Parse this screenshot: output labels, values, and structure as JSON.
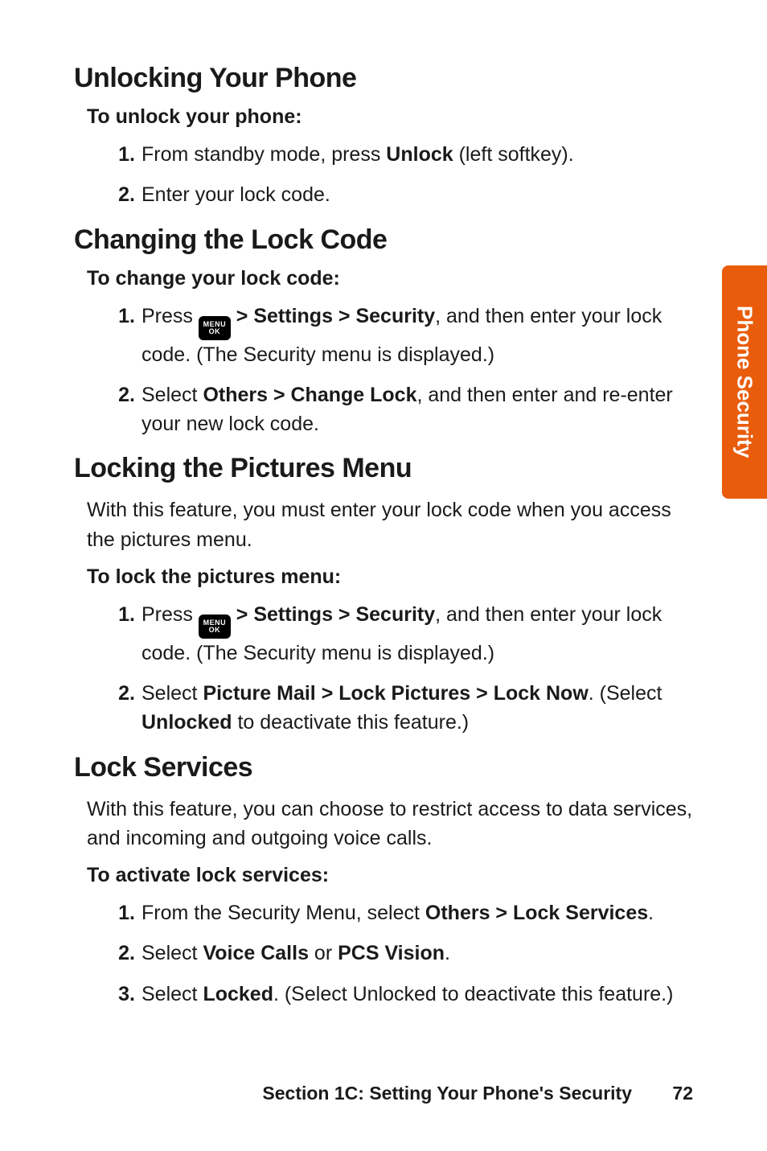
{
  "tab": {
    "label": "Phone Security"
  },
  "s1": {
    "heading": "Unlocking Your Phone",
    "lead": "To unlock your phone:",
    "step1_num": "1.",
    "step1_a": "From standby mode, press ",
    "step1_b": "Unlock",
    "step1_c": " (left softkey).",
    "step2_num": "2.",
    "step2": "Enter your lock code."
  },
  "s2": {
    "heading": "Changing the Lock Code",
    "lead": "To change your lock code:",
    "step1_num": "1.",
    "step1_a": "Press ",
    "step1_b": " > Settings > Security",
    "step1_c": ", and then enter your lock code. (The Security menu is displayed.)",
    "step2_num": "2.",
    "step2_a": "Select ",
    "step2_b": "Others > Change Lock",
    "step2_c": ", and then enter and re-enter your new lock code."
  },
  "s3": {
    "heading": "Locking the Pictures Menu",
    "intro": "With this feature, you must enter your lock code when you access the pictures menu.",
    "lead": "To lock the pictures menu:",
    "step1_num": "1.",
    "step1_a": "Press ",
    "step1_b": " > Settings > Security",
    "step1_c": ", and then enter your lock code. (The Security menu is displayed.)",
    "step2_num": "2.",
    "step2_a": "Select ",
    "step2_b": "Picture Mail > Lock Pictures > Lock Now",
    "step2_c": ". (Select ",
    "step2_d": "Unlocked",
    "step2_e": " to deactivate this feature.)"
  },
  "s4": {
    "heading": "Lock Services",
    "intro": "With this feature, you can choose to restrict access to data services, and incoming and outgoing voice calls.",
    "lead": "To activate lock services:",
    "step1_num": "1.",
    "step1_a": "From the Security Menu, select ",
    "step1_b": "Others > Lock Services",
    "step1_c": ".",
    "step2_num": "2.",
    "step2_a": "Select ",
    "step2_b": "Voice Calls",
    "step2_c": " or ",
    "step2_d": "PCS Vision",
    "step2_e": ".",
    "step3_num": "3.",
    "step3_a": "Select ",
    "step3_b": "Locked",
    "step3_c": ". (Select Unlocked to deactivate this feature.)"
  },
  "footer": {
    "text": "Section 1C: Setting Your Phone's Security",
    "page": "72"
  },
  "icon": {
    "l1": "MENU",
    "l2": "OK"
  }
}
